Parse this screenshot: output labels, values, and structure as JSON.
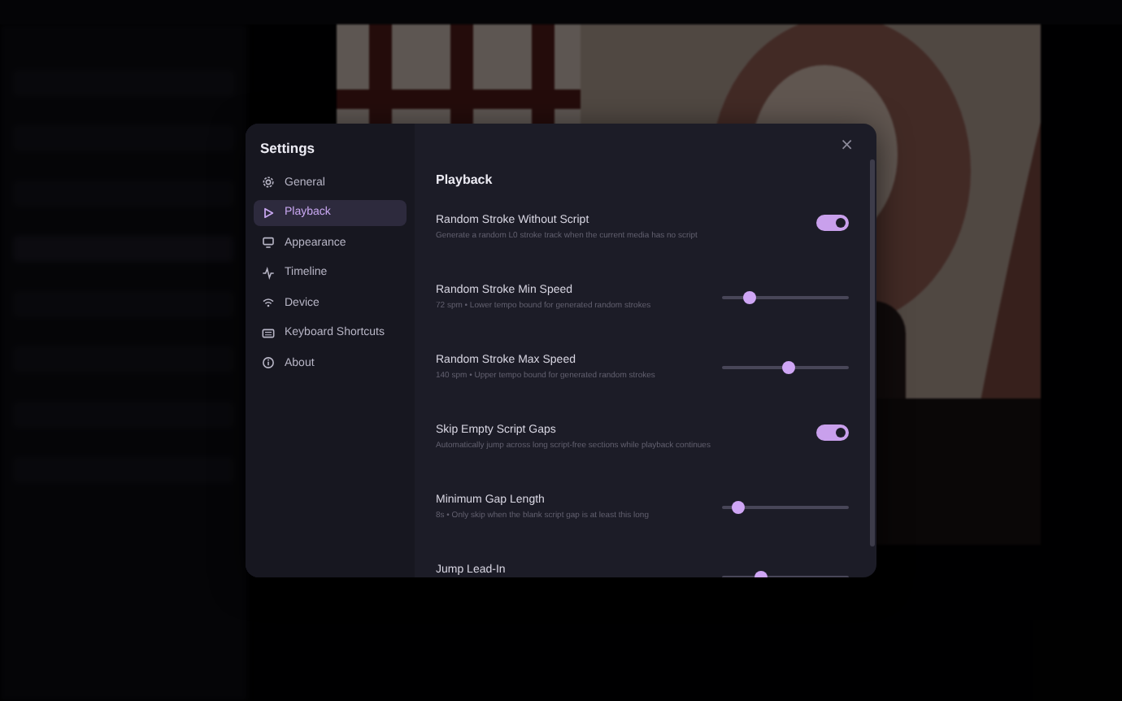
{
  "settings": {
    "title": "Settings",
    "close": "×",
    "nav": [
      {
        "label": "General",
        "selected": false
      },
      {
        "label": "Playback",
        "selected": true
      },
      {
        "label": "Appearance",
        "selected": false
      },
      {
        "label": "Timeline",
        "selected": false
      },
      {
        "label": "Device",
        "selected": false
      },
      {
        "label": "Keyboard Shortcuts",
        "selected": false
      },
      {
        "label": "About",
        "selected": false
      }
    ],
    "section_title": "Playback",
    "rows": [
      {
        "kind": "toggle",
        "title": "Random Stroke Without Script",
        "description": "Generate a random L0 stroke track when the current media has no script",
        "on": true
      },
      {
        "kind": "slider",
        "title": "Random Stroke Min Speed",
        "description": "72 spm • Lower tempo bound for generated random strokes",
        "level": 0.22
      },
      {
        "kind": "slider",
        "title": "Random Stroke Max Speed",
        "description": "140 spm • Upper tempo bound for generated random strokes",
        "level": 0.52
      },
      {
        "kind": "toggle",
        "title": "Skip Empty Script Gaps",
        "description": "Automatically jump across long script-free sections while playback continues",
        "on": true
      },
      {
        "kind": "slider",
        "title": "Minimum Gap Length",
        "description": "8s • Only skip when the blank script gap is at least this long",
        "level": 0.13
      },
      {
        "kind": "slider",
        "title": "Jump Lead-In",
        "level": 0.31
      }
    ]
  }
}
